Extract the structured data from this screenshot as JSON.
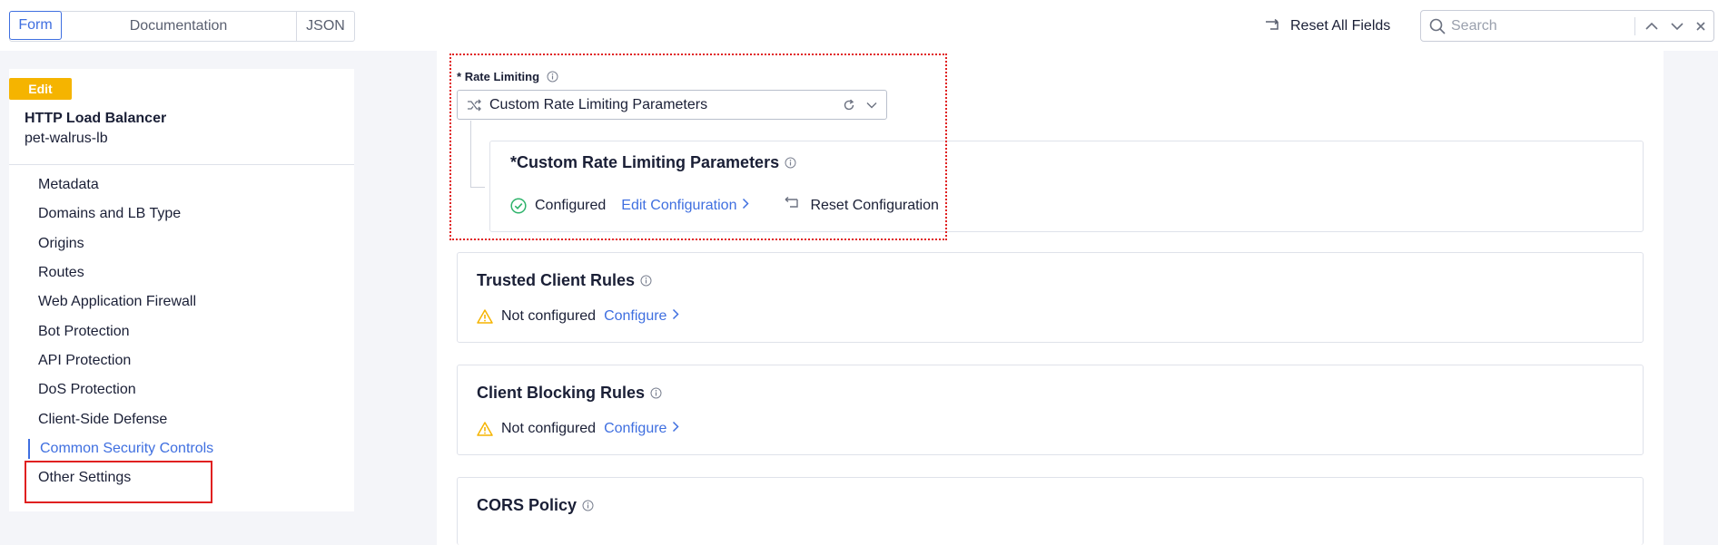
{
  "toolbar": {
    "tabs": [
      "Form",
      "Documentation",
      "JSON"
    ],
    "active_tab": "Form",
    "reset_all_label": "Reset All Fields",
    "search_placeholder": "Search"
  },
  "sidebar": {
    "badge": "Edit",
    "object_kind": "HTTP Load Balancer",
    "object_name": "pet-walrus-lb",
    "items": [
      {
        "label": "Metadata"
      },
      {
        "label": "Domains and LB Type"
      },
      {
        "label": "Origins"
      },
      {
        "label": "Routes"
      },
      {
        "label": "Web Application Firewall"
      },
      {
        "label": "Bot Protection"
      },
      {
        "label": "API Protection"
      },
      {
        "label": "DoS Protection"
      },
      {
        "label": "Client-Side Defense"
      },
      {
        "label": "Common Security Controls"
      },
      {
        "label": "Other Settings"
      }
    ],
    "active_item": "Common Security Controls"
  },
  "rate_limiting": {
    "required_mark": "*",
    "label": "Rate Limiting",
    "selected_value": "Custom Rate Limiting Parameters",
    "child": {
      "required_mark": "*",
      "title": "Custom Rate Limiting Parameters",
      "status": "Configured",
      "edit_link": "Edit Configuration",
      "reset_label": "Reset Configuration"
    }
  },
  "sections": [
    {
      "title": "Trusted Client Rules",
      "status": "Not configured",
      "action": "Configure"
    },
    {
      "title": "Client Blocking Rules",
      "status": "Not configured",
      "action": "Configure"
    },
    {
      "title": "CORS Policy"
    }
  ],
  "colors": {
    "accent": "#3f6fe0",
    "edit_badge": "#f5b400",
    "success": "#2eb36b",
    "warning": "#f5b400",
    "highlight": "#e02020"
  }
}
